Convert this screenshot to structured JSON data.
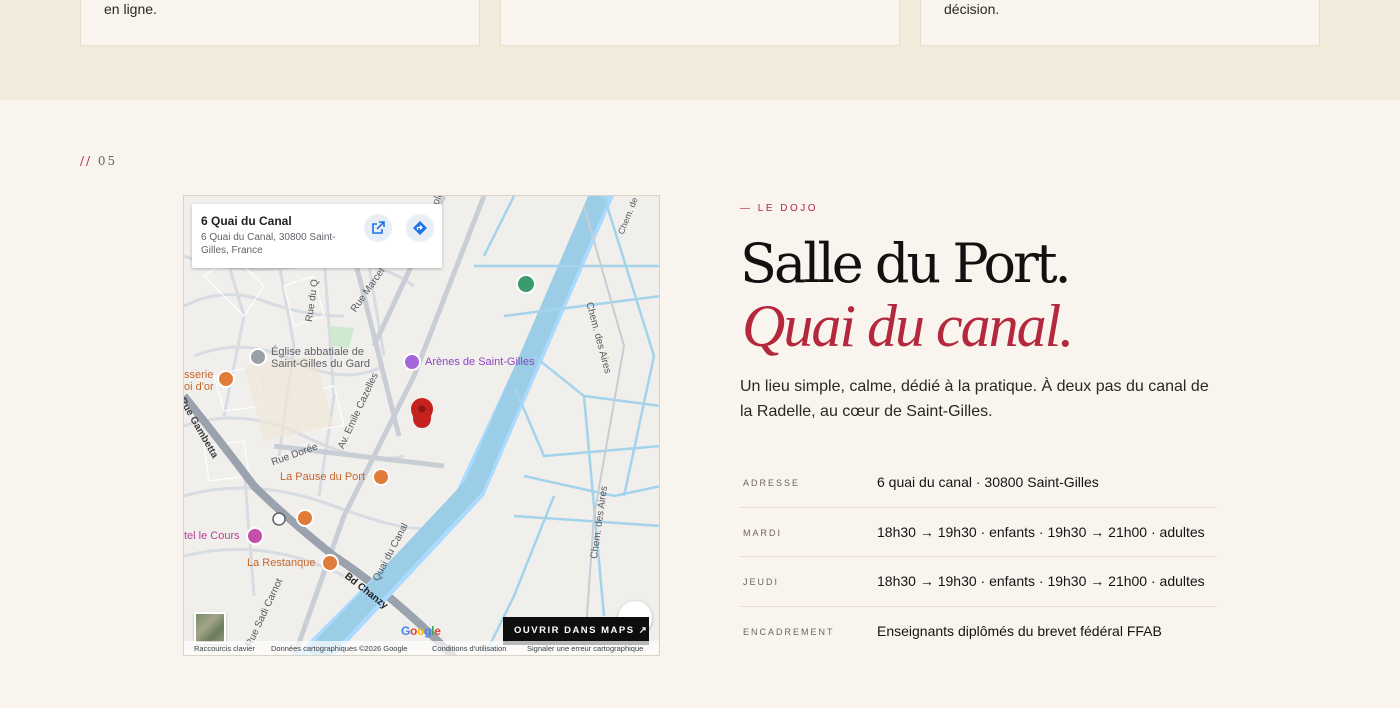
{
  "top_cards": [
    {
      "text": "en ligne."
    },
    {
      "text": ""
    },
    {
      "text": "décision."
    }
  ],
  "section": {
    "slashes": "//",
    "number": "05"
  },
  "map": {
    "place_title": "6 Quai du Canal",
    "place_address": "6 Quai du Canal, 30800 Saint-Gilles, France",
    "labels": {
      "eglise": "Église abbatiale de Saint-Gilles du Gard",
      "arenes": "Arènes de Saint-Gilles",
      "pause": "La Pause du Port",
      "cours": "tel le Cours",
      "restanque": "La Restanque",
      "brasserie": "sserie",
      "brasserie2": "oi d'or"
    },
    "streets": {
      "anatole": "Av. Anatole France",
      "marcel": "Rue Marcel",
      "rue_q": "Rue du Q",
      "cazelles": "Av. Emile Cazelles",
      "doree": "Rue Dorée",
      "gambetta": "Rue Gambetta",
      "quai": "Quai du Canal",
      "chanzy": "Bd Chanzy",
      "carnot": "Rue Sadi Carnot",
      "aires1": "Chem. des Aires",
      "aires2": "Chem. des Aires",
      "chem": "Chem. de"
    },
    "open_button": "OUVRIR DANS MAPS ↗",
    "google": "Google",
    "footer": {
      "shortcuts": "Raccourcis clavier",
      "data": "Données cartographiques ©2026 Google",
      "terms": "Conditions d'utilisation",
      "report": "Signaler une erreur cartographique"
    }
  },
  "dojo": {
    "eyebrow": "— LE DOJO",
    "title": "Salle du Port.",
    "subtitle": "Quai du canal.",
    "intro": "Un lieu simple, calme, dédié à la pratique. À deux pas du canal de la Radelle, au cœur de Saint-Gilles."
  },
  "info": [
    {
      "key": "ADRESSE",
      "value": "6 quai du canal · 30800 Saint-Gilles"
    },
    {
      "key": "MARDI",
      "value": "18h30 → 19h30 · enfants  ·  19h30 → 21h00 · adultes"
    },
    {
      "key": "JEUDI",
      "value": "18h30 → 19h30 · enfants  ·  19h30 → 21h00 · adultes"
    },
    {
      "key": "ENCADREMENT",
      "value": "Enseignants diplômés du brevet fédéral FFAB"
    }
  ],
  "colors": {
    "accent": "#b3283d",
    "background": "#f9f5ee",
    "band": "#f2eadb"
  }
}
